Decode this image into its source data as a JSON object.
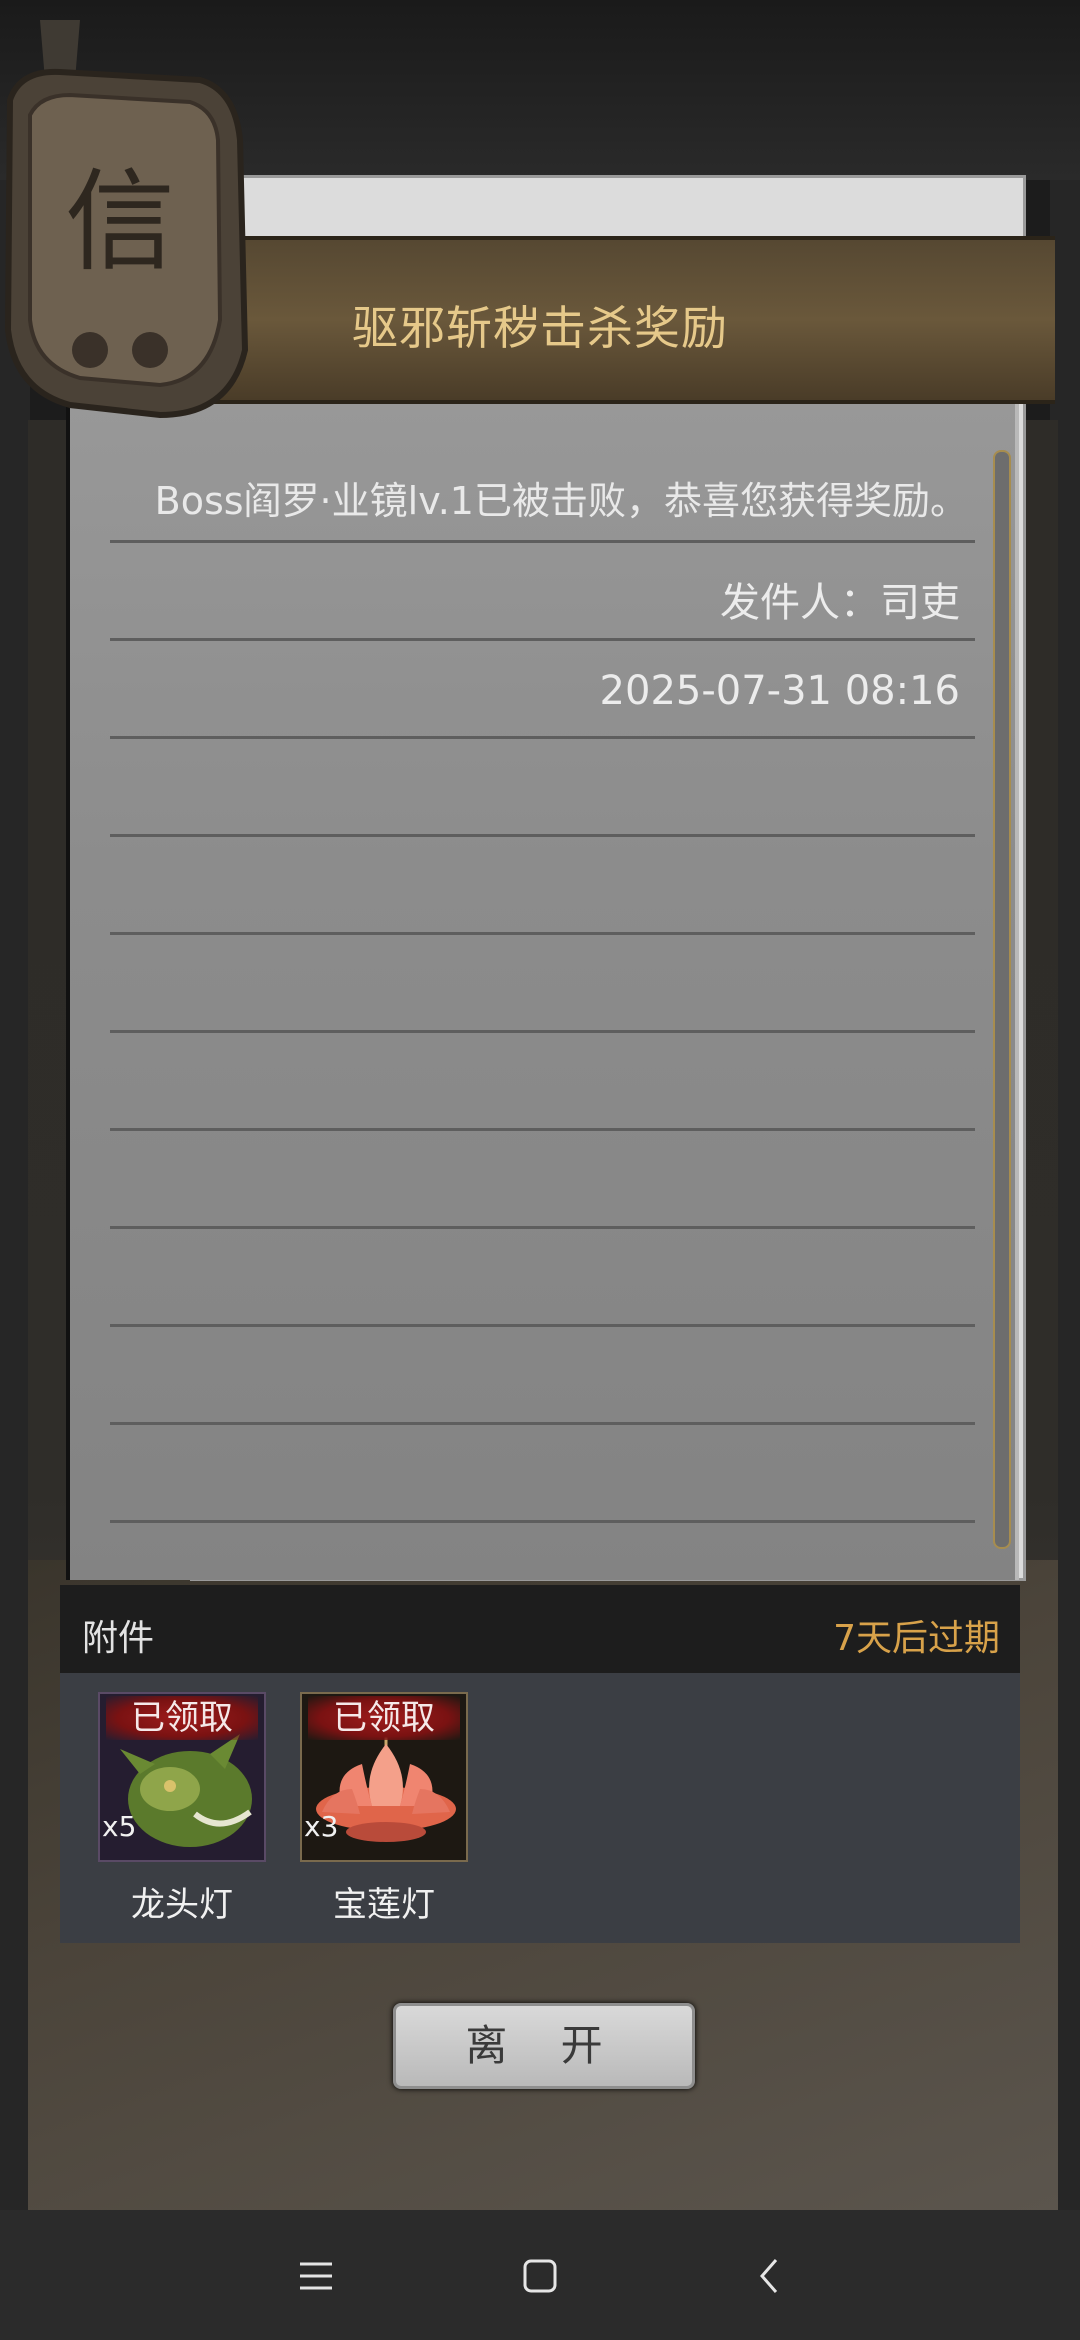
{
  "mail": {
    "title": "驱邪斩秽击杀奖励",
    "body": "Boss阎罗·业镜lv.1已被击败，恭喜您获得奖励。",
    "sender": "发件人：司吏",
    "datetime": "2025-07-31 08:16"
  },
  "attachments": {
    "label": "附件",
    "expire_text": "7天后过期",
    "items": [
      {
        "claimed": "已领取",
        "quantity": "x5",
        "name": "龙头灯",
        "icon": "dragon-head-lantern-icon"
      },
      {
        "claimed": "已领取",
        "quantity": "x3",
        "name": "宝莲灯",
        "icon": "lotus-lantern-icon"
      }
    ]
  },
  "leave_button": "离 开",
  "seal_character": "信",
  "colors": {
    "title": "#e6c98a",
    "expire": "#d8a24a",
    "claimed_badge": "#9e1b1b"
  },
  "system_nav": [
    "menu-icon",
    "home-icon",
    "back-icon"
  ]
}
